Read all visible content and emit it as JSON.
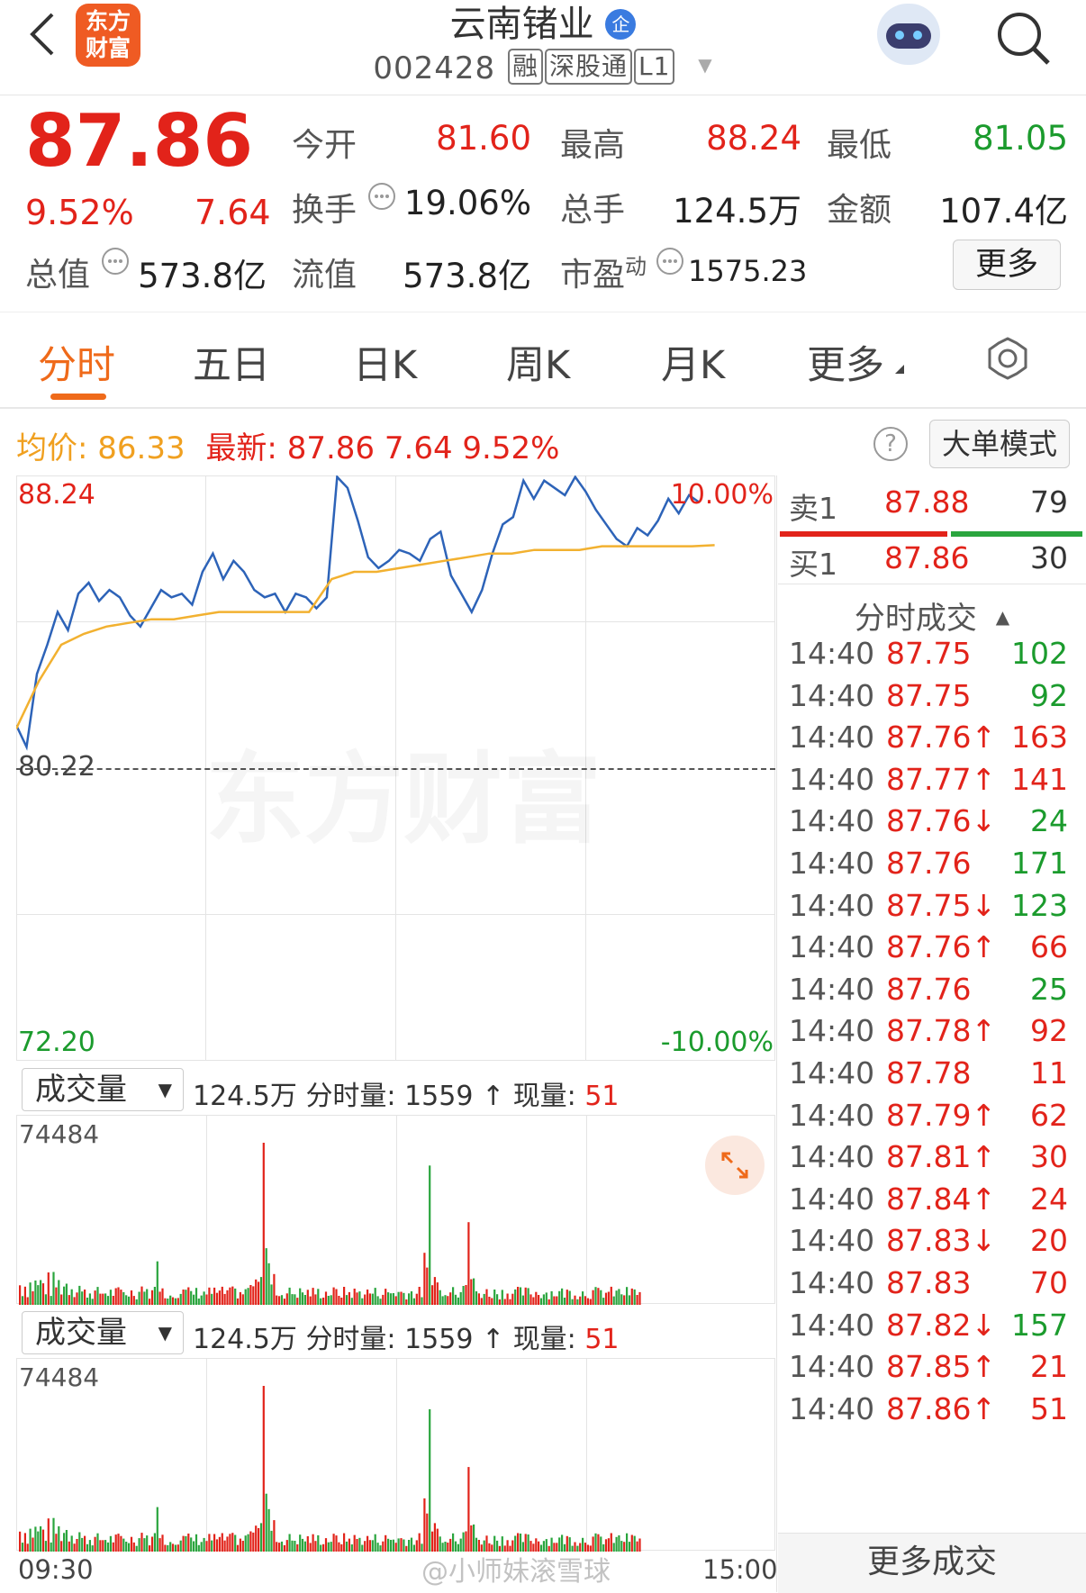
{
  "header": {
    "logo_line1": "东方",
    "logo_line2": "财富",
    "title": "云南锗业",
    "badge": "企",
    "code": "002428",
    "tags": [
      "融",
      "深股通",
      "L1"
    ]
  },
  "quote": {
    "price": "87.86",
    "change_pct": "9.52%",
    "change": "7.64",
    "items": [
      {
        "label": "今开",
        "value": "81.60"
      },
      {
        "label": "最高",
        "value": "88.24"
      },
      {
        "label": "最低",
        "value": "81.05"
      },
      {
        "label": "换手",
        "value": "19.06%"
      },
      {
        "label": "总手",
        "value": "124.5万"
      },
      {
        "label": "金额",
        "value": "107.4亿"
      },
      {
        "label": "总值",
        "value": "573.8亿"
      },
      {
        "label": "流值",
        "value": "573.8亿"
      },
      {
        "label": "市盈",
        "value": "1575.23"
      }
    ],
    "pe_sup": "动",
    "more_button": "更多"
  },
  "tabs": [
    "分时",
    "五日",
    "日K",
    "周K",
    "月K",
    "更多"
  ],
  "info_bar": {
    "avg_label": "均价:",
    "avg_value": "86.33",
    "latest_label": "最新:",
    "latest_value": "87.86",
    "latest_change": "7.64",
    "latest_pct": "9.52%",
    "help": "?",
    "mode_button": "大单模式"
  },
  "chart_data": {
    "type": "line",
    "y_max_label": "88.24",
    "y_min_label": "72.20",
    "pct_max_label": "10.00%",
    "pct_min_label": "-10.00%",
    "prev_close_label": "80.22",
    "ylim": [
      72.2,
      88.24
    ],
    "x_start": "09:30",
    "x_end": "15:00",
    "watermark": "东方财富",
    "series": [
      {
        "values": [
          81.4,
          80.8,
          82.8,
          83.6,
          84.5,
          84.0,
          85.0,
          85.3,
          84.8,
          85.1,
          84.9,
          84.4,
          84.1,
          84.6,
          85.1,
          84.9,
          85.0,
          84.7,
          85.6,
          86.1,
          85.4,
          85.9,
          85.6,
          85.1,
          84.9,
          85.0,
          84.5,
          85.0,
          84.9,
          84.6,
          84.9,
          88.2,
          87.9,
          87.0,
          86.0,
          85.7,
          85.9,
          86.2,
          86.1,
          85.9,
          86.5,
          86.7,
          85.5,
          85.0,
          84.5,
          85.1,
          86.1,
          86.9,
          87.1,
          88.1,
          87.6,
          88.1,
          87.9,
          87.7,
          88.2,
          87.8,
          87.3,
          86.9,
          86.5,
          86.3,
          86.8,
          86.6,
          87.0,
          87.6,
          87.2,
          87.7,
          87.5
        ]
      },
      {
        "values": [
          81.3,
          82.6,
          83.6,
          83.9,
          84.1,
          84.2,
          84.3,
          84.3,
          84.4,
          84.5,
          84.5,
          84.5,
          84.5,
          84.5,
          85.4,
          85.6,
          85.6,
          85.7,
          85.8,
          85.9,
          86.0,
          86.1,
          86.1,
          86.2,
          86.2,
          86.2,
          86.3,
          86.3,
          86.3,
          86.3,
          86.3,
          86.33
        ]
      }
    ],
    "volume": {
      "header_select": "成交量",
      "total": "124.5万",
      "period_label": "分时量:",
      "period_value": "1559",
      "period_arrow": "↑",
      "now_label": "现量:",
      "now_value": "51",
      "y_max_label": "74484",
      "peaks": [
        {
          "t": 0.39,
          "v": 74484
        },
        {
          "t": 0.66,
          "v": 64000
        },
        {
          "t": 0.72,
          "v": 38000
        },
        {
          "t": 0.22,
          "v": 20000
        }
      ]
    }
  },
  "book": {
    "sell_label": "卖1",
    "sell_price": "87.88",
    "sell_vol": "79",
    "buy_label": "买1",
    "buy_price": "87.86",
    "buy_vol": "30"
  },
  "trades_header": "分时成交",
  "trades": [
    {
      "time": "14:40",
      "price": "87.75",
      "dir": "",
      "vol": "102",
      "side": "buy"
    },
    {
      "time": "14:40",
      "price": "87.75",
      "dir": "",
      "vol": "92",
      "side": "buy"
    },
    {
      "time": "14:40",
      "price": "87.76",
      "dir": "↑",
      "vol": "163",
      "side": "sell"
    },
    {
      "time": "14:40",
      "price": "87.77",
      "dir": "↑",
      "vol": "141",
      "side": "sell"
    },
    {
      "time": "14:40",
      "price": "87.76",
      "dir": "↓",
      "vol": "24",
      "side": "buy"
    },
    {
      "time": "14:40",
      "price": "87.76",
      "dir": "",
      "vol": "171",
      "side": "buy"
    },
    {
      "time": "14:40",
      "price": "87.75",
      "dir": "↓",
      "vol": "123",
      "side": "buy"
    },
    {
      "time": "14:40",
      "price": "87.76",
      "dir": "↑",
      "vol": "66",
      "side": "sell"
    },
    {
      "time": "14:40",
      "price": "87.76",
      "dir": "",
      "vol": "25",
      "side": "buy"
    },
    {
      "time": "14:40",
      "price": "87.78",
      "dir": "↑",
      "vol": "92",
      "side": "sell"
    },
    {
      "time": "14:40",
      "price": "87.78",
      "dir": "",
      "vol": "11",
      "side": "sell"
    },
    {
      "time": "14:40",
      "price": "87.79",
      "dir": "↑",
      "vol": "62",
      "side": "sell"
    },
    {
      "time": "14:40",
      "price": "87.81",
      "dir": "↑",
      "vol": "30",
      "side": "sell"
    },
    {
      "time": "14:40",
      "price": "87.84",
      "dir": "↑",
      "vol": "24",
      "side": "sell"
    },
    {
      "time": "14:40",
      "price": "87.83",
      "dir": "↓",
      "vol": "20",
      "side": "sell"
    },
    {
      "time": "14:40",
      "price": "87.83",
      "dir": "",
      "vol": "70",
      "side": "sell"
    },
    {
      "time": "14:40",
      "price": "87.82",
      "dir": "↓",
      "vol": "157",
      "side": "buy"
    },
    {
      "time": "14:40",
      "price": "87.85",
      "dir": "↑",
      "vol": "21",
      "side": "sell"
    },
    {
      "time": "14:40",
      "price": "87.86",
      "dir": "↑",
      "vol": "51",
      "side": "sell"
    }
  ],
  "more_trades_button": "更多成交",
  "weibo_watermark": "@小师妹滚雪球"
}
